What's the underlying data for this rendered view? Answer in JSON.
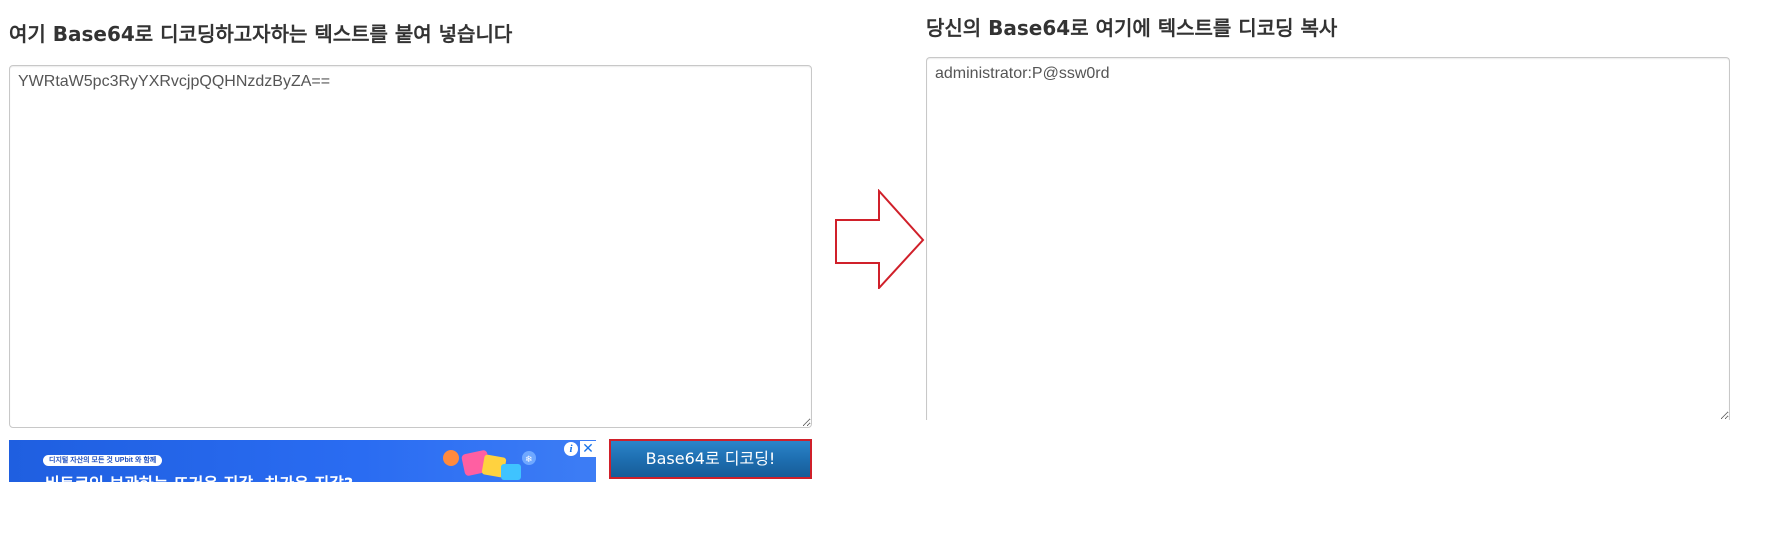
{
  "input_panel": {
    "heading": "여기 Base64로 디코딩하고자하는 텍스트를 붙여 넣습니다",
    "value": "YWRtaW5pc3RyYXRvcjpQQHNzdzByZA=="
  },
  "output_panel": {
    "heading": "당신의 Base64로 여기에 텍스트를 디코딩 복사",
    "value": "administrator:P@ssw0rd"
  },
  "actions": {
    "decode_label": "Base64로 디코딩!"
  },
  "ad": {
    "tag": "디지털 자산의 모든 것 UPbit 와 함께",
    "headline": "비트코인 보관하는 뜨거운 지갑, 차가운 지갑?",
    "info_glyph": "i",
    "close_glyph": "✕"
  },
  "colors": {
    "arrow_stroke": "#d0202a",
    "button_border": "#d0202a",
    "button_fill": "#1e6fb1",
    "ad_background": "#2a6cf2"
  }
}
